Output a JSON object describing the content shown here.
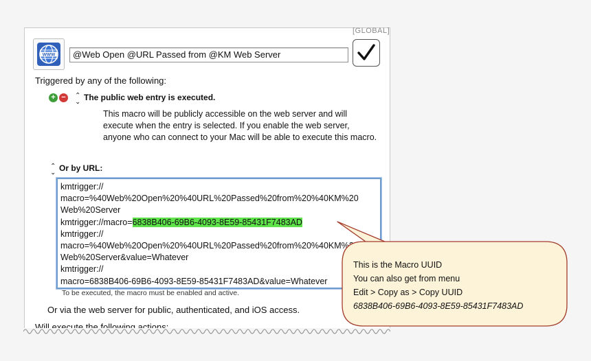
{
  "macro": {
    "scope_tag": "[GLOBAL]",
    "title": "@Web Open @URL Passed from @KM Web Server",
    "icon": "www-globe-icon",
    "enabled": true
  },
  "triggers": {
    "heading": "Triggered by any of the following:",
    "web_entry": {
      "title": "The public web entry is executed.",
      "description": "This macro will be publicly accessible on the web server and will execute when the entry is selected.  If you enable the web server, anyone who can connect to your Mac will be able to execute this macro."
    },
    "url": {
      "label": "Or by URL:",
      "lines": [
        "kmtrigger://",
        "macro=%40Web%20Open%20%40URL%20Passed%20from%20%40KM%20",
        "Web%20Server",
        "kmtrigger://macro=",
        "6838B406-69B6-4093-8E59-85431F7483AD",
        "kmtrigger://",
        "macro=%40Web%20Open%20%40URL%20Passed%20from%20%40KM%20",
        "Web%20Server&value=Whatever",
        "kmtrigger://",
        "macro=6838B406-69B6-4093-8E59-85431F7483AD&value=Whatever"
      ],
      "note": "To be executed, the macro must be enabled and active."
    },
    "web_server_line": "Or via the web server for public, authenticated, and iOS access.",
    "actions_heading": "Will execute the following actions:"
  },
  "callout": {
    "line1": "This is the Macro UUID",
    "line2": "You can also get from menu",
    "line3": "Edit > Copy as > Copy UUID",
    "uuid": "6838B406-69B6-4093-8E59-85431F7483AD",
    "fill": "#fdf3d8",
    "stroke": "#a33b2a"
  },
  "colors": {
    "highlight": "#5ee34a",
    "add_button": "#3e9f3a",
    "remove_button": "#d23a3a",
    "focus_ring": "#6e9ccf"
  }
}
